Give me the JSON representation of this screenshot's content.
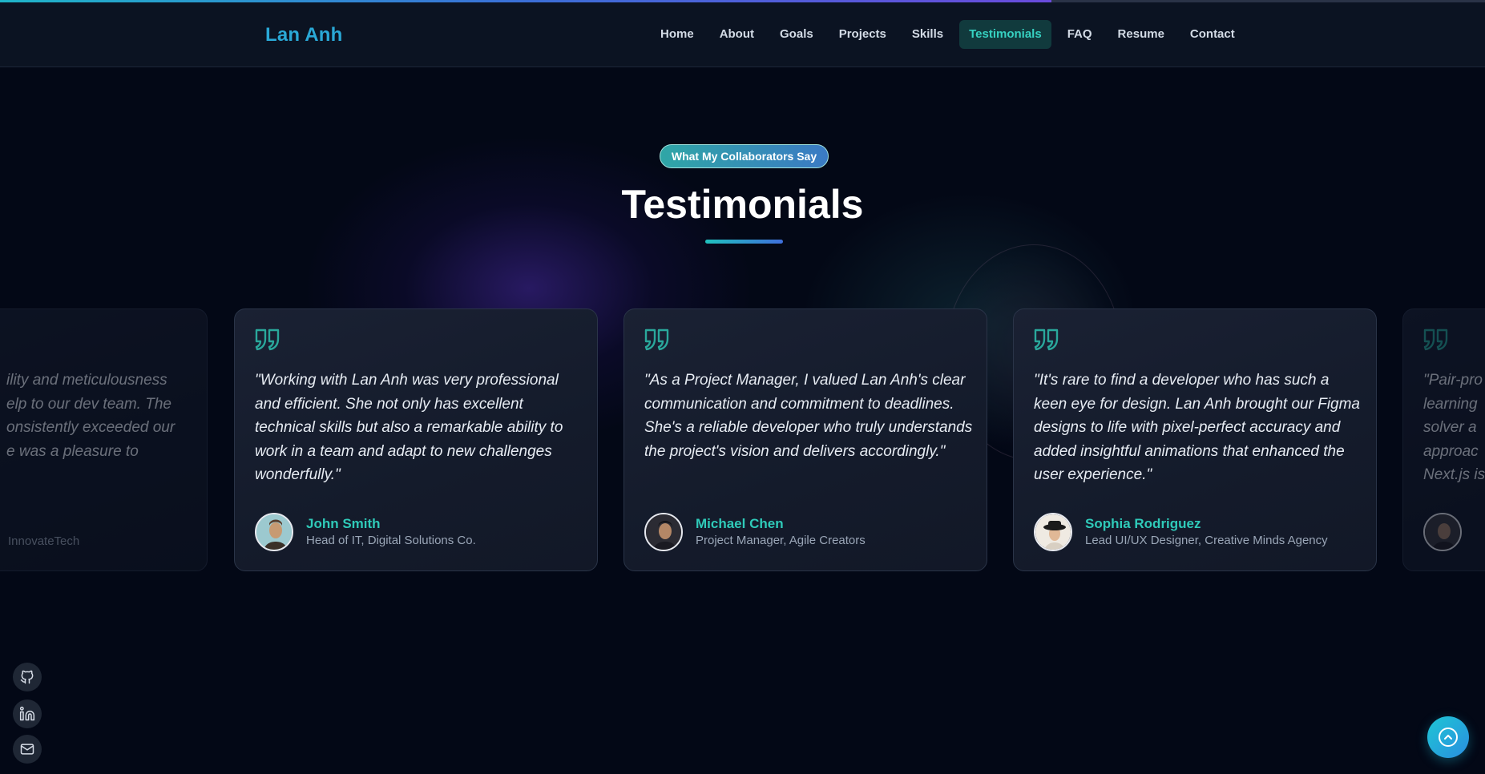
{
  "brand": "Lan Anh",
  "nav": {
    "items": [
      "Home",
      "About",
      "Goals",
      "Projects",
      "Skills",
      "Testimonials",
      "FAQ",
      "Resume",
      "Contact"
    ],
    "active": "Testimonials"
  },
  "scroll_progress": 0.708,
  "section": {
    "badge": "What My Collaborators Say",
    "title": "Testimonials"
  },
  "testimonials": [
    {
      "quote_lines": [
        "ility and meticulousness",
        "elp to our dev team. The",
        "onsistently exceeded our",
        "e was a pleasure to"
      ],
      "name": "",
      "role": "InnovateTech"
    },
    {
      "quote": "\"Working with Lan Anh was very professional and efficient. She not only has excellent technical skills but also a remarkable ability to work in a team and adapt to new challenges wonderfully.\"",
      "name": "John Smith",
      "role": "Head of IT, Digital Solutions Co."
    },
    {
      "quote": "\"As a Project Manager, I valued Lan Anh's clear communication and commitment to deadlines. She's a reliable developer who truly understands the project's vision and delivers accordingly.\"",
      "name": "Michael Chen",
      "role": "Project Manager, Agile Creators"
    },
    {
      "quote": "\"It's rare to find a developer who has such a keen eye for design. Lan Anh brought our Figma designs to life with pixel-perfect accuracy and added insightful animations that enhanced the user experience.\"",
      "name": "Sophia Rodriguez",
      "role": "Lead UI/UX Designer, Creative Minds Agency"
    },
    {
      "quote_lines": [
        "\"Pair-pro",
        "learning",
        "solver a",
        "approac",
        "Next.js is"
      ],
      "name": "",
      "role": ""
    }
  ],
  "social": [
    "github-icon",
    "linkedin-icon",
    "mail-icon"
  ],
  "colors": {
    "accent": "#2fcab9",
    "brand": "#2aa8d6",
    "background": "#030816"
  }
}
